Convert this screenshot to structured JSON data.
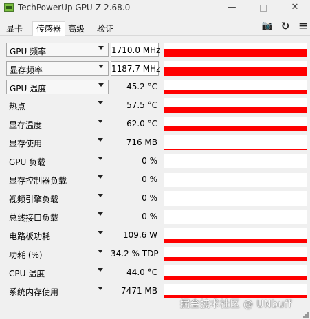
{
  "window": {
    "title": "TechPowerUp GPU-Z 2.68.0",
    "minimize": "—",
    "close": "✕"
  },
  "tabs": [
    {
      "label": "显卡",
      "active": false
    },
    {
      "label": "传感器",
      "active": true
    },
    {
      "label": "高级",
      "active": false
    },
    {
      "label": "验证",
      "active": false
    }
  ],
  "toolbar_icons": [
    "camera-icon",
    "refresh-icon",
    "menu-icon"
  ],
  "toolbar_glyphs": {
    "camera": "📷",
    "refresh": "↻",
    "menu": "≡"
  },
  "graph_color": "#ff0000",
  "sensors": [
    {
      "label": "GPU 频率",
      "value": "1710.0 MHz",
      "boxed": true,
      "fill": 0.55
    },
    {
      "label": "显存频率",
      "value": "1187.7 MHz",
      "boxed": true,
      "fill": 0.55
    },
    {
      "label": "GPU 温度",
      "value": "45.2 °C",
      "boxed": false,
      "label_boxed": true,
      "fill": 0.3
    },
    {
      "label": "热点",
      "value": "57.5 °C",
      "boxed": false,
      "fill": 0.38
    },
    {
      "label": "显存温度",
      "value": "62.0 °C",
      "boxed": false,
      "fill": 0.4
    },
    {
      "label": "显存使用",
      "value": "716 MB",
      "boxed": false,
      "fill": 0.06
    },
    {
      "label": "GPU 负载",
      "value": "0 %",
      "boxed": false,
      "fill": 0
    },
    {
      "label": "显存控制器负载",
      "value": "0 %",
      "boxed": false,
      "fill": 0
    },
    {
      "label": "视频引擎负载",
      "value": "0 %",
      "boxed": false,
      "fill": 0
    },
    {
      "label": "总线接口负载",
      "value": "0 %",
      "boxed": false,
      "fill": 0
    },
    {
      "label": "电路板功耗",
      "value": "109.6 W",
      "boxed": false,
      "fill": 0.3
    },
    {
      "label": "功耗 (%)",
      "value": "34.2 % TDP",
      "boxed": false,
      "fill": 0.3
    },
    {
      "label": "CPU 温度",
      "value": "44.0 °C",
      "boxed": false,
      "fill": 0.25
    },
    {
      "label": "系统内存使用",
      "value": "7471 MB",
      "boxed": false,
      "fill": 0.25
    }
  ],
  "watermark": "掘金技术社区 @ UNbuff"
}
